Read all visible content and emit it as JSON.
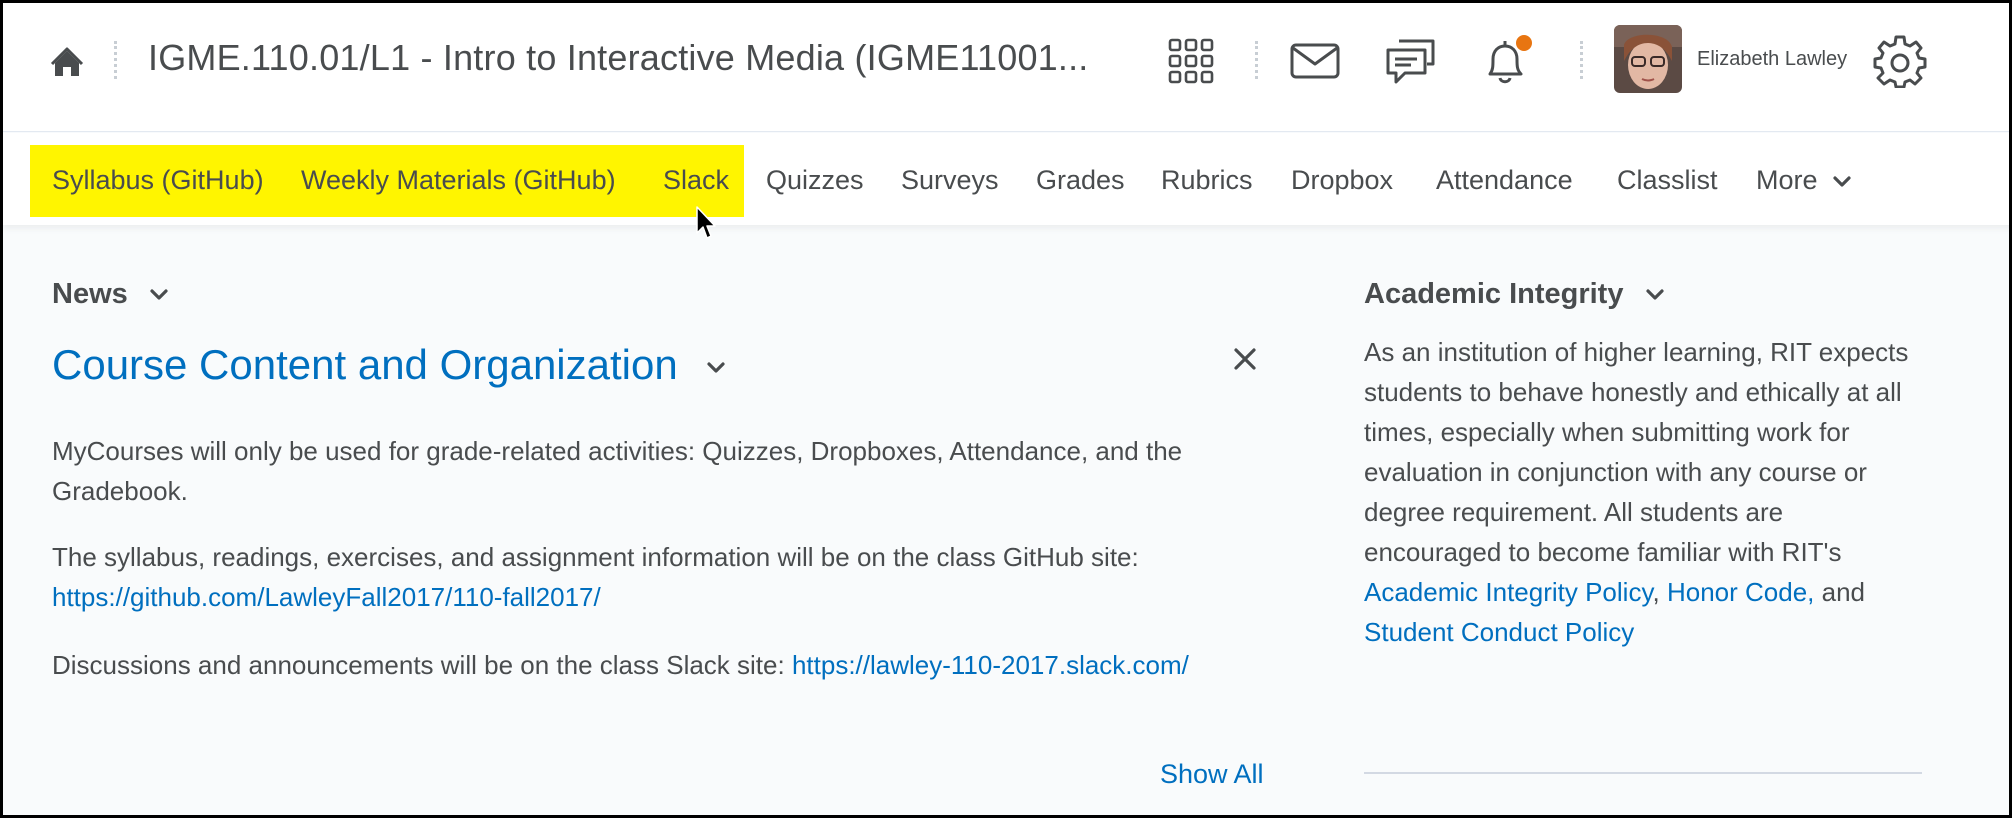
{
  "header": {
    "course_title": "IGME.110.01/L1 - Intro to Interactive Media (IGME11001...",
    "user_name": "Elizabeth Lawley",
    "icons": [
      "home-icon",
      "apps-grid-icon",
      "mail-icon",
      "chat-icon",
      "bell-icon",
      "gear-icon"
    ],
    "notification_color": "#e87511"
  },
  "nav": {
    "items": [
      {
        "label": "Syllabus (GitHub)"
      },
      {
        "label": "Weekly Materials (GitHub)"
      },
      {
        "label": "Slack"
      },
      {
        "label": "Quizzes"
      },
      {
        "label": "Surveys"
      },
      {
        "label": "Grades"
      },
      {
        "label": "Rubrics"
      },
      {
        "label": "Dropbox"
      },
      {
        "label": "Attendance"
      },
      {
        "label": "Classlist"
      },
      {
        "label": "More"
      }
    ],
    "highlight_color": "#fff500"
  },
  "news": {
    "heading": "News",
    "item_title": "Course Content and Organization",
    "p1": "MyCourses will only be used for grade-related activities: Quizzes, Dropboxes, Attendance, and the Gradebook.",
    "p2_text": "The syllabus, readings, exercises, and assignment information will be on the class GitHub site:",
    "p2_link": "https://github.com/LawleyFall2017/110-fall2017/",
    "p3_text": "Discussions and announcements will be on the class Slack site:",
    "p3_link": "https://lawley-110-2017.slack.com/",
    "show_all": "Show All"
  },
  "academic_integrity": {
    "heading": "Academic Integrity",
    "body": "As an institution of higher learning, RIT expects students to behave honestly and ethically at all times, especially when submitting work for evaluation in conjunction with any course or degree requirement. All students are encouraged to become familiar with RIT's",
    "link1": "Academic Integrity Policy",
    "sep1": ",",
    "link2": "Honor Code,",
    "and": "and",
    "link3": "Student Conduct Policy"
  },
  "colors": {
    "link": "#006fbf",
    "text": "#494c4e"
  }
}
